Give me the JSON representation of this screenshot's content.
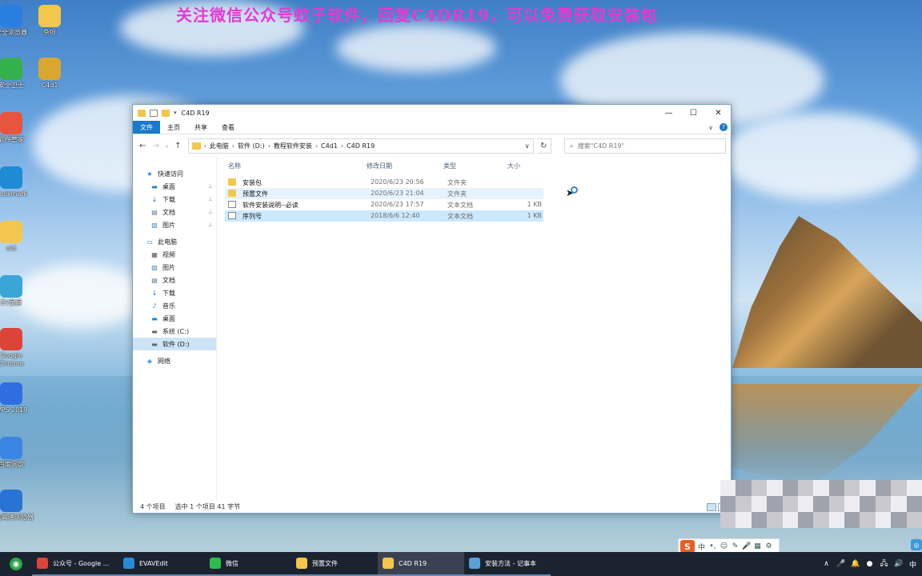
{
  "banner": "关注微信公众号蚊子软件，回复C4DR19，可以免费获取安装包",
  "desktop_icons": [
    {
      "label": "安全浏览器",
      "icon": "browser-icon",
      "color": "#2a7de1"
    },
    {
      "label": "杂项",
      "icon": "folder-icon",
      "color": "#f2c74b"
    },
    {
      "label": "安全卫士",
      "icon": "shield-icon",
      "color": "#36b04a"
    },
    {
      "label": "C4d1",
      "icon": "zip-icon",
      "color": "#d9a730"
    },
    {
      "label": "软件管家",
      "icon": "apps-icon",
      "color": "#e8553e"
    },
    {
      "label": "Bookmark",
      "icon": "ie-icon",
      "color": "#1f8ad6"
    },
    {
      "label": "old",
      "icon": "folder-icon",
      "color": "#f2c74b"
    },
    {
      "label": "EV录屏",
      "icon": "recorder-icon",
      "color": "#3aa6d8"
    },
    {
      "label": "Google Chrome",
      "icon": "chrome-icon",
      "color": "#db4437"
    },
    {
      "label": "WPS 2019",
      "icon": "wps-icon",
      "color": "#2f6ee0"
    },
    {
      "label": "百度网盘",
      "icon": "cloud-icon",
      "color": "#3b86e4"
    },
    {
      "label": "搜狗高速浏览器",
      "icon": "sogou-icon",
      "color": "#2873d4"
    }
  ],
  "window": {
    "title": "C4D R19",
    "controls": {
      "minimize": "—",
      "maximize": "☐",
      "close": "✕"
    },
    "ribbon_tabs": [
      "文件",
      "主页",
      "共享",
      "查看"
    ],
    "ribbon_expand": "∨",
    "help": "?",
    "nav": {
      "back": "←",
      "forward": "→",
      "recent": "∨",
      "up": "↑"
    },
    "breadcrumbs": [
      "此电脑",
      "软件 (D:)",
      "教程软件安装",
      "C4d1",
      "C4D R19"
    ],
    "address_dropdown": "∨",
    "refresh": "↻",
    "search_placeholder": "搜索\"C4D R19\"",
    "nav_pane": [
      {
        "label": "快速访问",
        "icon": "star-icon",
        "glyph": "★",
        "color": "#2a7de1",
        "indent": 0,
        "pinned": false
      },
      {
        "label": "桌面",
        "icon": "desktop-icon",
        "glyph": "▬",
        "color": "#1e88d8",
        "indent": 1,
        "pinned": true
      },
      {
        "label": "下载",
        "icon": "download-icon",
        "glyph": "↓",
        "color": "#1e6fc8",
        "indent": 1,
        "pinned": true
      },
      {
        "label": "文档",
        "icon": "document-icon",
        "glyph": "▤",
        "color": "#5a7a9a",
        "indent": 1,
        "pinned": true
      },
      {
        "label": "图片",
        "icon": "pictures-icon",
        "glyph": "▧",
        "color": "#4a8ab8",
        "indent": 1,
        "pinned": true
      },
      {
        "label": "此电脑",
        "icon": "computer-icon",
        "glyph": "▭",
        "color": "#3a7ab8",
        "indent": 0,
        "pinned": false
      },
      {
        "label": "视频",
        "icon": "video-icon",
        "glyph": "▦",
        "color": "#555",
        "indent": 1,
        "pinned": false
      },
      {
        "label": "图片",
        "icon": "pictures-icon",
        "glyph": "▧",
        "color": "#4a8ab8",
        "indent": 1,
        "pinned": false
      },
      {
        "label": "文档",
        "icon": "document-icon",
        "glyph": "▤",
        "color": "#5a7a9a",
        "indent": 1,
        "pinned": false
      },
      {
        "label": "下载",
        "icon": "download-icon",
        "glyph": "↓",
        "color": "#1e6fc8",
        "indent": 1,
        "pinned": false
      },
      {
        "label": "音乐",
        "icon": "music-icon",
        "glyph": "♪",
        "color": "#1e6fc8",
        "indent": 1,
        "pinned": false
      },
      {
        "label": "桌面",
        "icon": "desktop-icon",
        "glyph": "▬",
        "color": "#1e88d8",
        "indent": 1,
        "pinned": false
      },
      {
        "label": "系统 (C:)",
        "icon": "drive-icon",
        "glyph": "▬",
        "color": "#666",
        "indent": 1,
        "pinned": false
      },
      {
        "label": "软件 (D:)",
        "icon": "drive-icon",
        "glyph": "▬",
        "color": "#666",
        "indent": 1,
        "pinned": false,
        "selected": true
      },
      {
        "label": "网络",
        "icon": "network-icon",
        "glyph": "◈",
        "color": "#2a7de1",
        "indent": 0,
        "pinned": false
      }
    ],
    "pin_glyph": "📌",
    "columns": {
      "name": "名称",
      "date": "修改日期",
      "type": "类型",
      "size": "大小"
    },
    "files": [
      {
        "name": "安装包",
        "date": "2020/6/23 20:56",
        "type": "文件夹",
        "size": "",
        "kind": "folder",
        "state": ""
      },
      {
        "name": "预置文件",
        "date": "2020/6/23 21:04",
        "type": "文件夹",
        "size": "",
        "kind": "folder",
        "state": "hover"
      },
      {
        "name": "软件安装说明--必读",
        "date": "2020/6/23 17:57",
        "type": "文本文档",
        "size": "1 KB",
        "kind": "doc",
        "state": ""
      },
      {
        "name": "序列号",
        "date": "2018/6/6 12:40",
        "type": "文本文档",
        "size": "1 KB",
        "kind": "doc",
        "state": "selected"
      }
    ],
    "status": {
      "count": "4 个项目",
      "selection": "选中 1 个项目  41 字节"
    }
  },
  "ime": {
    "logo": "S",
    "mode": "中",
    "items": [
      "•,",
      "☺",
      "✎",
      "🎤",
      "▦",
      "⚙"
    ]
  },
  "taskbar": {
    "items": [
      {
        "label": "公众号 - Google ...",
        "icon": "chrome-icon",
        "color": "#db4437",
        "active": false
      },
      {
        "label": "EVAVEdit",
        "icon": "video-edit-icon",
        "color": "#2a8ad6",
        "active": false
      },
      {
        "label": "微信",
        "icon": "wechat-icon",
        "color": "#2dbb4e",
        "active": false
      },
      {
        "label": "预置文件",
        "icon": "folder-icon",
        "color": "#f2c74b",
        "active": false
      },
      {
        "label": "C4D R19",
        "icon": "folder-icon",
        "color": "#f2c74b",
        "active": true
      },
      {
        "label": "安装方法 - 记事本",
        "icon": "notepad-icon",
        "color": "#5aa0d8",
        "active": false
      }
    ],
    "tray": [
      "∧",
      "🎤",
      "🔔",
      "●",
      "🖧",
      "🔊",
      "中"
    ]
  }
}
